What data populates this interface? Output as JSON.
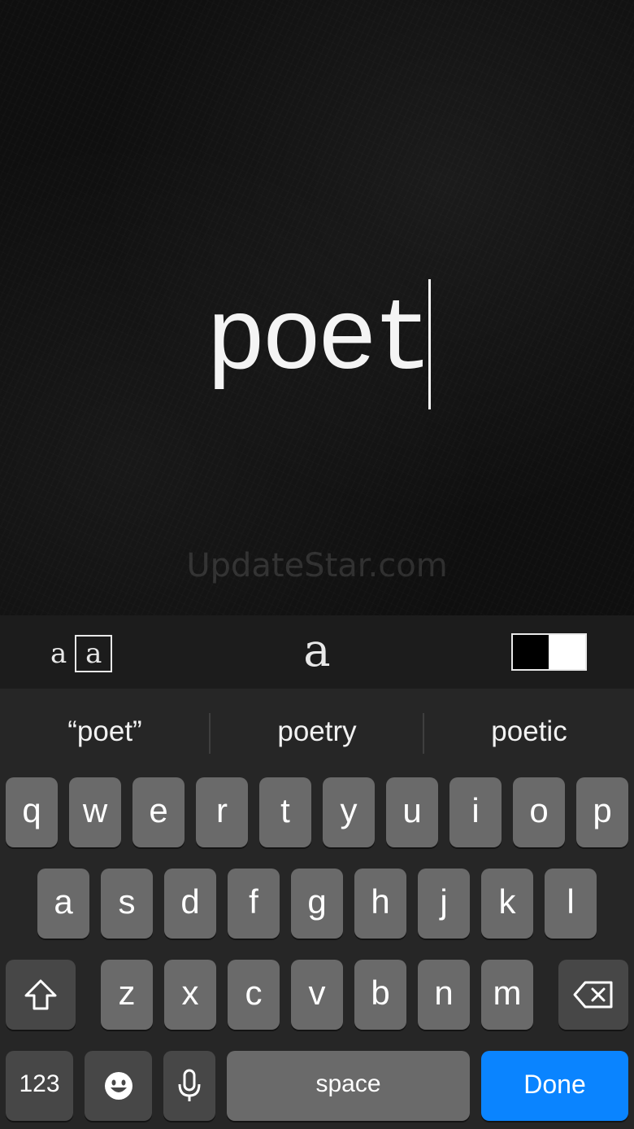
{
  "canvas": {
    "text": "poet",
    "watermark": "UpdateStar.com"
  },
  "style_bar": {
    "size_small": "a",
    "size_large": "a",
    "font_glyph": "a",
    "color_toggle": {
      "left": "#000000",
      "right": "#ffffff"
    }
  },
  "keyboard": {
    "suggestions": [
      "“poet”",
      "poetry",
      "poetic"
    ],
    "row1": [
      "q",
      "w",
      "e",
      "r",
      "t",
      "y",
      "u",
      "i",
      "o",
      "p"
    ],
    "row2": [
      "a",
      "s",
      "d",
      "f",
      "g",
      "h",
      "j",
      "k",
      "l"
    ],
    "row3": [
      "z",
      "x",
      "c",
      "v",
      "b",
      "n",
      "m"
    ],
    "numbers_label": "123",
    "space_label": "space",
    "done_label": "Done",
    "icons": {
      "shift": "shift-icon",
      "delete": "backspace-icon",
      "emoji": "emoji-icon",
      "mic": "microphone-icon"
    },
    "accent_color": "#0a84ff"
  }
}
